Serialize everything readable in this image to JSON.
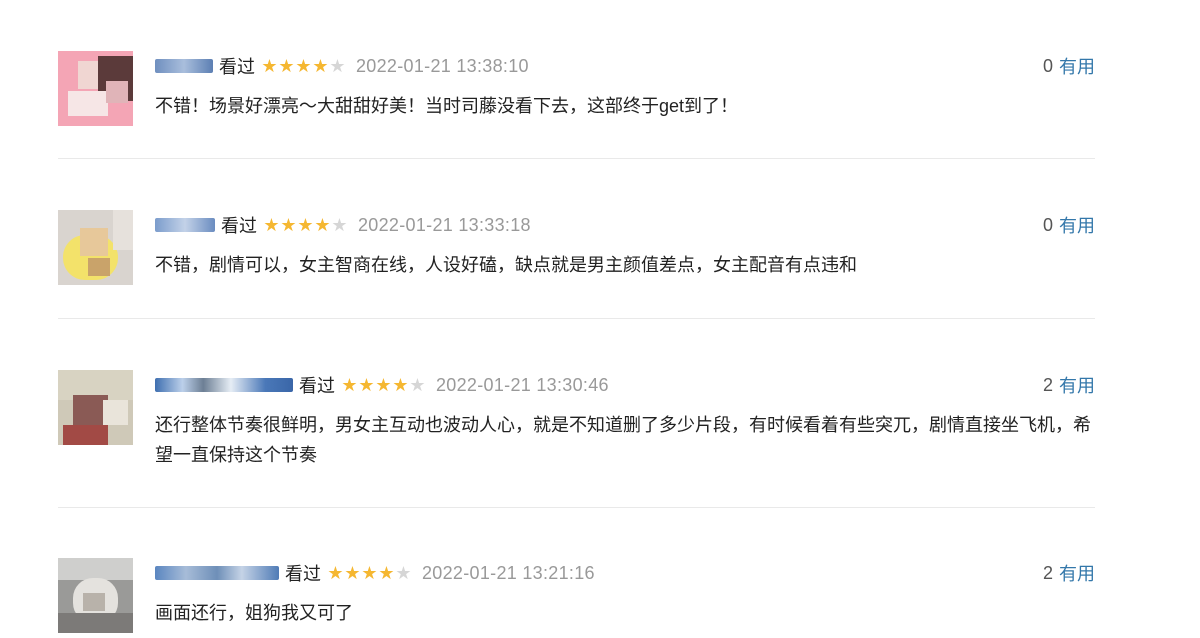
{
  "status_label": "看过",
  "useful_label": "有用",
  "colors": {
    "star_on": "#f5b731",
    "star_off": "#d6d6d6",
    "link": "#3377aa",
    "timestamp": "#999999"
  },
  "reviews": [
    {
      "rating_stars": 4,
      "timestamp": "2022-01-21 13:38:10",
      "useful_count": "0",
      "comment": "不错！场景好漂亮～大甜甜好美！当时司藤没看下去，这部终于get到了！"
    },
    {
      "rating_stars": 4,
      "timestamp": "2022-01-21 13:33:18",
      "useful_count": "0",
      "comment": "不错，剧情可以，女主智商在线，人设好磕，缺点就是男主颜值差点，女主配音有点违和"
    },
    {
      "rating_stars": 4,
      "timestamp": "2022-01-21 13:30:46",
      "useful_count": "2",
      "comment": "还行整体节奏很鲜明，男女主互动也波动人心，就是不知道删了多少片段，有时候看着有些突兀，剧情直接坐飞机，希望一直保持这个节奏"
    },
    {
      "rating_stars": 4,
      "timestamp": "2022-01-21 13:21:16",
      "useful_count": "2",
      "comment": "画面还行，姐狗我又可了"
    }
  ]
}
